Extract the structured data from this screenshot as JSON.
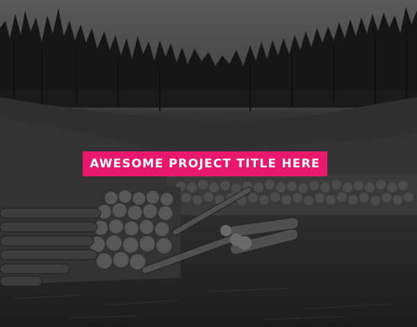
{
  "hero": {
    "title": "AWESOME PROJECT TITLE HERE",
    "accent_color": "#e8186d",
    "image_subject": "forest-clearing-log-pile-photo"
  }
}
